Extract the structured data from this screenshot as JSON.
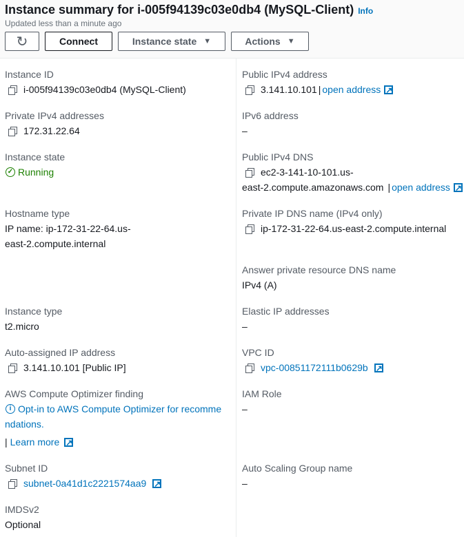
{
  "header": {
    "title": "Instance summary for i-005f94139c03e0db4 (MySQL-Client)",
    "info": "Info",
    "updated": "Updated less than a minute ago",
    "buttons": {
      "connect": "Connect",
      "instance_state": "Instance state",
      "actions": "Actions"
    }
  },
  "left": {
    "instance_id": {
      "label": "Instance ID",
      "value": "i-005f94139c03e0db4 (MySQL-Client)"
    },
    "private_ipv4": {
      "label": "Private IPv4 addresses",
      "value": "172.31.22.64"
    },
    "instance_state": {
      "label": "Instance state",
      "value": "Running"
    },
    "hostname_type": {
      "label": "Hostname type",
      "line1": "IP name: ip-172-31-22-64.us-",
      "line2": "east-2.compute.internal"
    },
    "instance_type": {
      "label": "Instance type",
      "value": "t2.micro"
    },
    "auto_ip": {
      "label": "Auto-assigned IP address",
      "value": "3.141.10.101 [Public IP]"
    },
    "optimizer": {
      "label": "AWS Compute Optimizer finding",
      "line1": "Opt-in to AWS Compute Optimizer for recomme",
      "line2": "ndations.",
      "sep": "|",
      "learn_more": "Learn more"
    },
    "subnet": {
      "label": "Subnet ID",
      "value": "subnet-0a41d1c2221574aa9"
    },
    "imdsv2": {
      "label": "IMDSv2",
      "value": "Optional"
    }
  },
  "right": {
    "public_ipv4": {
      "label": "Public IPv4 address",
      "value": "3.141.10.101",
      "sep": "|",
      "link": "open address"
    },
    "ipv6": {
      "label": "IPv6 address",
      "value": "–"
    },
    "public_dns": {
      "label": "Public IPv4 DNS",
      "line1": "ec2-3-141-10-101.us-",
      "line2": "east-2.compute.amazonaws.com",
      "sep": "|",
      "link": "open address"
    },
    "private_dns": {
      "label": "Private IP DNS name (IPv4 only)",
      "value": "ip-172-31-22-64.us-east-2.compute.internal"
    },
    "answer_dns": {
      "label": "Answer private resource DNS name",
      "value": "IPv4 (A)"
    },
    "elastic_ip": {
      "label": "Elastic IP addresses",
      "value": "–"
    },
    "vpc": {
      "label": "VPC ID",
      "value": "vpc-00851172111b0629b"
    },
    "iam": {
      "label": "IAM Role",
      "value": "–"
    },
    "asg": {
      "label": "Auto Scaling Group name",
      "value": "–"
    }
  }
}
